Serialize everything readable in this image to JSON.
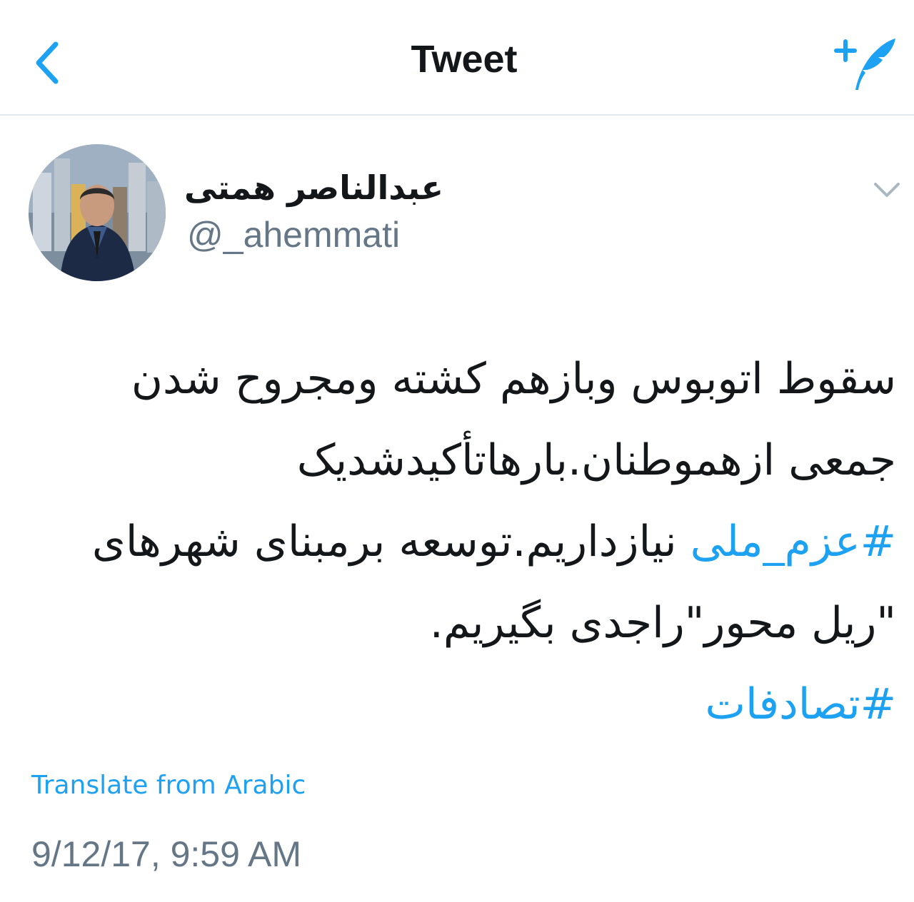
{
  "header": {
    "title": "Tweet",
    "back_icon": "chevron-left-icon",
    "compose_icon": "compose-tweet-icon"
  },
  "author": {
    "display_name": "عبدالناصر همتی",
    "username": "@_ahemmati",
    "menu_icon": "chevron-down-icon"
  },
  "tweet": {
    "lines": [
      [
        {
          "text": "سقوط اتوبوس وبازهم کشته ومجروح شدن",
          "hashtag": false
        }
      ],
      [
        {
          "text": "جمعی ازهموطنان.بارهاتأکیدشدیک",
          "hashtag": false
        }
      ],
      [
        {
          "text": "#عزم_ملی",
          "hashtag": true
        },
        {
          "text": " نیازداریم.توسعه برمبنای شهرهای",
          "hashtag": false
        }
      ],
      [
        {
          "text": "\"ریل محور\"راجدی بگیریم.",
          "hashtag": false
        }
      ],
      [
        {
          "text": "#تصادفات",
          "hashtag": true
        }
      ]
    ],
    "translate_label": "Translate from Arabic",
    "timestamp": "9/12/17, 9:59 AM"
  },
  "colors": {
    "accent": "#1da1f2",
    "text": "#14171a",
    "muted": "#657786",
    "divider": "#e1e8ed"
  }
}
